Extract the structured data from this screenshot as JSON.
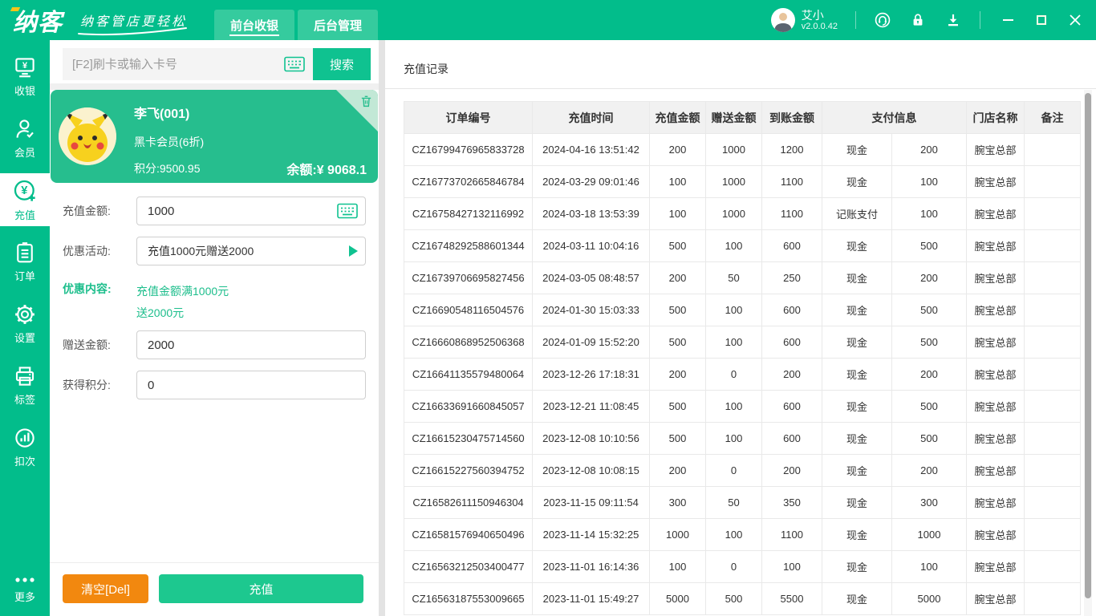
{
  "colors": {
    "brand_green": "#02BD8B",
    "tab_green": "#35CB9E",
    "card_green": "#26BE8E",
    "button_green": "#1DC88F",
    "button_orange": "#F2880F",
    "promo_text_green": "#1DBE8C"
  },
  "topbar": {
    "logo": "纳客",
    "tagline": "纳客管店更轻松",
    "tabs": [
      {
        "label": "前台收银",
        "active": true
      },
      {
        "label": "后台管理",
        "active": false
      }
    ],
    "user": {
      "name": "艾小",
      "version": "v2.0.0.42"
    }
  },
  "sidebar": {
    "items": [
      {
        "label": "收银",
        "icon": "cashier-monitor-icon"
      },
      {
        "label": "会员",
        "icon": "member-person-icon"
      },
      {
        "label": "充值",
        "icon": "recharge-yen-icon",
        "active": true
      },
      {
        "label": "订单",
        "icon": "orders-clipboard-icon"
      },
      {
        "label": "设置",
        "icon": "settings-gear-icon"
      },
      {
        "label": "标签",
        "icon": "label-printer-icon"
      },
      {
        "label": "扣次",
        "icon": "deduct-chart-icon"
      },
      {
        "label": "更多",
        "icon": "more-dots-icon"
      }
    ]
  },
  "search": {
    "placeholder": "[F2]刷卡或输入卡号",
    "button_label": "搜索"
  },
  "member": {
    "name": "李飞(001)",
    "level": "黑卡会员(6折)",
    "points": "积分:9500.95",
    "balance": "余额:¥ 9068.1"
  },
  "form": {
    "recharge_amount": {
      "label": "充值金额:",
      "value": "1000"
    },
    "promo_activity": {
      "label": "优惠活动:",
      "value": "充值1000元赠送2000"
    },
    "promo_content": {
      "label": "优惠内容:",
      "line1": "充值金额满1000元",
      "line2": "送2000元"
    },
    "gift_amount": {
      "label": "赠送金额:",
      "value": "2000"
    },
    "gain_points": {
      "label": "获得积分:",
      "value": "0"
    },
    "clear_button_label": "清空[Del]",
    "recharge_button_label": "充值"
  },
  "records": {
    "title": "充值记录",
    "columns": [
      {
        "label": "订单编号",
        "span": 1
      },
      {
        "label": "充值时间",
        "span": 1
      },
      {
        "label": "充值金额",
        "span": 1
      },
      {
        "label": "赠送金额",
        "span": 1
      },
      {
        "label": "到账金额",
        "span": 1
      },
      {
        "label": "支付信息",
        "span": 2
      },
      {
        "label": "门店名称",
        "span": 1
      },
      {
        "label": "备注",
        "span": 1
      }
    ],
    "rows": [
      [
        "CZ16799476965833728",
        "2024-04-16 13:51:42",
        "200",
        "1000",
        "1200",
        "现金",
        "200",
        "腕宝总部",
        ""
      ],
      [
        "CZ16773702665846784",
        "2024-03-29 09:01:46",
        "100",
        "1000",
        "1100",
        "现金",
        "100",
        "腕宝总部",
        ""
      ],
      [
        "CZ16758427132116992",
        "2024-03-18 13:53:39",
        "100",
        "1000",
        "1100",
        "记账支付",
        "100",
        "腕宝总部",
        ""
      ],
      [
        "CZ16748292588601344",
        "2024-03-11 10:04:16",
        "500",
        "100",
        "600",
        "现金",
        "500",
        "腕宝总部",
        ""
      ],
      [
        "CZ16739706695827456",
        "2024-03-05 08:48:57",
        "200",
        "50",
        "250",
        "现金",
        "200",
        "腕宝总部",
        ""
      ],
      [
        "CZ16690548116504576",
        "2024-01-30 15:03:33",
        "500",
        "100",
        "600",
        "现金",
        "500",
        "腕宝总部",
        ""
      ],
      [
        "CZ16660868952506368",
        "2024-01-09 15:52:20",
        "500",
        "100",
        "600",
        "现金",
        "500",
        "腕宝总部",
        ""
      ],
      [
        "CZ16641135579480064",
        "2023-12-26 17:18:31",
        "200",
        "0",
        "200",
        "现金",
        "200",
        "腕宝总部",
        ""
      ],
      [
        "CZ16633691660845057",
        "2023-12-21 11:08:45",
        "500",
        "100",
        "600",
        "现金",
        "500",
        "腕宝总部",
        ""
      ],
      [
        "CZ16615230475714560",
        "2023-12-08 10:10:56",
        "500",
        "100",
        "600",
        "现金",
        "500",
        "腕宝总部",
        ""
      ],
      [
        "CZ16615227560394752",
        "2023-12-08 10:08:15",
        "200",
        "0",
        "200",
        "现金",
        "200",
        "腕宝总部",
        ""
      ],
      [
        "CZ16582611150946304",
        "2023-11-15 09:11:54",
        "300",
        "50",
        "350",
        "现金",
        "300",
        "腕宝总部",
        ""
      ],
      [
        "CZ16581576940650496",
        "2023-11-14 15:32:25",
        "1000",
        "100",
        "1100",
        "现金",
        "1000",
        "腕宝总部",
        ""
      ],
      [
        "CZ16563212503400477",
        "2023-11-01 16:14:36",
        "100",
        "0",
        "100",
        "现金",
        "100",
        "腕宝总部",
        ""
      ],
      [
        "CZ16563187553009665",
        "2023-11-01 15:49:27",
        "5000",
        "500",
        "5500",
        "现金",
        "5000",
        "腕宝总部",
        ""
      ]
    ]
  }
}
